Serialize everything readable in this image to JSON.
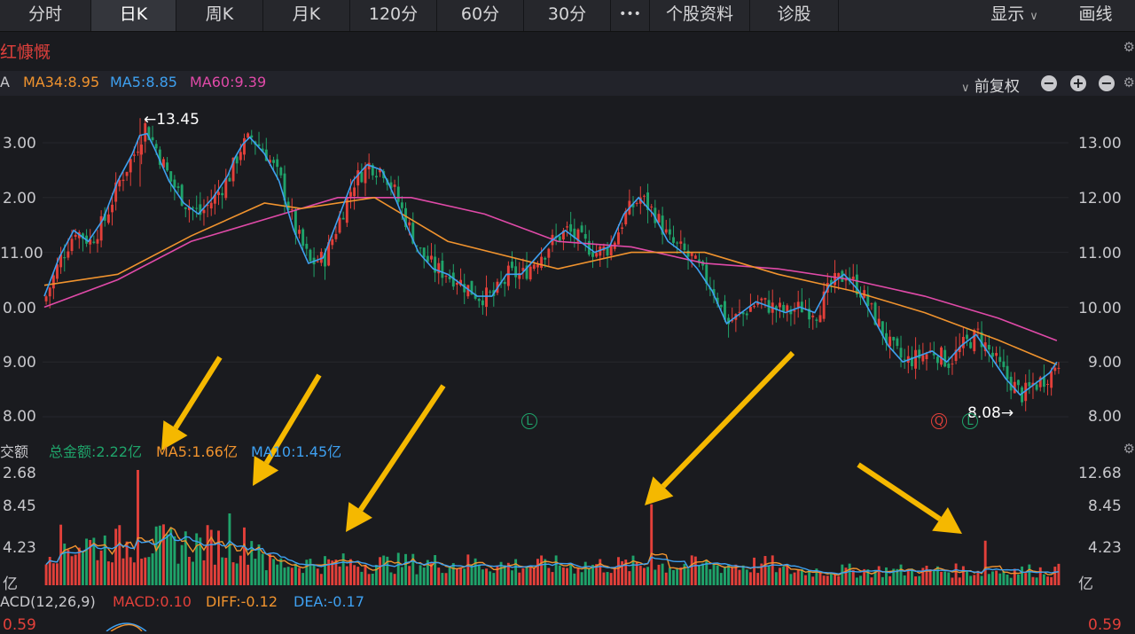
{
  "tabs": [
    "分时",
    "日K",
    "周K",
    "月K",
    "120分",
    "60分",
    "30分",
    "•••",
    "个股资料",
    "诊股"
  ],
  "active_tab": "日K",
  "right_tabs": {
    "display": "显示",
    "draw": "画线"
  },
  "stock_name": "红慷慨",
  "ma_header": {
    "prefix": "A",
    "ma34": "MA34:8.95",
    "ma5": "MA5:8.85",
    "ma60": "MA60:9.39",
    "adjust": "前复权",
    "btn_minus": "−",
    "btn_plus": "+",
    "btn_minus2": "−"
  },
  "colors": {
    "up": "#e3403a",
    "down": "#1fa36a",
    "ma5": "#3ea0f0",
    "ma34": "#f0932e",
    "ma60": "#e04aa8",
    "bg": "#1a1b1f",
    "arrow": "#f5b800"
  },
  "price_axis": {
    "left": [
      "3.00",
      "2.00",
      "11.00",
      "0.00",
      "9.00",
      "8.00"
    ],
    "right": [
      "13.00",
      "12.00",
      "11.00",
      "10.00",
      "9.00",
      "8.00"
    ]
  },
  "annotations": {
    "high": "←13.45",
    "low": "8.08→",
    "marker_l": "L",
    "marker_q": "Q"
  },
  "volume_header": {
    "prefix": "交额",
    "total": "总金额:2.22亿",
    "ma5": "MA5:1.66亿",
    "ma10": "MA10:1.45亿"
  },
  "volume_axis": {
    "left": [
      "2.68",
      "8.45",
      "4.23",
      "亿"
    ],
    "right": [
      "12.68",
      "8.45",
      "4.23",
      "亿"
    ]
  },
  "macd_header": {
    "prefix": "ACD(12,26,9)",
    "macd": "MACD:0.10",
    "diff": "DIFF:-0.12",
    "dea": "DEA:-0.17"
  },
  "macd_axis": {
    "left": "0.59",
    "right": "0.59"
  },
  "chart_data": {
    "type": "candlestick",
    "price_range": [
      8.0,
      13.0
    ],
    "high": 13.45,
    "low": 8.08,
    "close_path": [
      [
        0,
        10.2
      ],
      [
        4,
        10.9
      ],
      [
        8,
        11.4
      ],
      [
        12,
        11.2
      ],
      [
        16,
        11.6
      ],
      [
        20,
        12.3
      ],
      [
        24,
        12.8
      ],
      [
        27,
        13.3
      ],
      [
        30,
        12.9
      ],
      [
        34,
        12.3
      ],
      [
        38,
        11.9
      ],
      [
        42,
        11.7
      ],
      [
        46,
        12.0
      ],
      [
        50,
        12.4
      ],
      [
        53,
        12.9
      ],
      [
        56,
        13.1
      ],
      [
        60,
        12.8
      ],
      [
        64,
        12.3
      ],
      [
        68,
        11.4
      ],
      [
        72,
        10.8
      ],
      [
        76,
        10.9
      ],
      [
        80,
        11.6
      ],
      [
        84,
        12.3
      ],
      [
        88,
        12.6
      ],
      [
        92,
        12.5
      ],
      [
        95,
        12.1
      ],
      [
        98,
        11.6
      ],
      [
        102,
        11.0
      ],
      [
        106,
        10.7
      ],
      [
        110,
        10.6
      ],
      [
        114,
        10.4
      ],
      [
        118,
        10.2
      ],
      [
        122,
        10.2
      ],
      [
        126,
        10.6
      ],
      [
        130,
        10.6
      ],
      [
        134,
        10.9
      ],
      [
        138,
        11.2
      ],
      [
        142,
        11.4
      ],
      [
        146,
        11.2
      ],
      [
        150,
        11.0
      ],
      [
        154,
        11.1
      ],
      [
        158,
        11.7
      ],
      [
        162,
        12.0
      ],
      [
        166,
        11.7
      ],
      [
        170,
        11.2
      ],
      [
        174,
        11.0
      ],
      [
        178,
        10.7
      ],
      [
        182,
        10.3
      ],
      [
        186,
        9.7
      ],
      [
        190,
        9.9
      ],
      [
        194,
        10.1
      ],
      [
        198,
        10.0
      ],
      [
        202,
        9.9
      ],
      [
        206,
        10.0
      ],
      [
        210,
        9.9
      ],
      [
        214,
        10.4
      ],
      [
        218,
        10.6
      ],
      [
        222,
        10.3
      ],
      [
        226,
        9.8
      ],
      [
        230,
        9.3
      ],
      [
        234,
        9.0
      ],
      [
        238,
        9.1
      ],
      [
        242,
        9.2
      ],
      [
        246,
        9.0
      ],
      [
        250,
        9.3
      ],
      [
        254,
        9.5
      ],
      [
        258,
        9.1
      ],
      [
        262,
        8.7
      ],
      [
        266,
        8.4
      ],
      [
        270,
        8.6
      ],
      [
        274,
        8.8
      ],
      [
        276,
        9.0
      ]
    ],
    "ma34_path": [
      [
        0,
        10.4
      ],
      [
        20,
        10.6
      ],
      [
        40,
        11.3
      ],
      [
        60,
        11.9
      ],
      [
        70,
        11.8
      ],
      [
        90,
        12.0
      ],
      [
        110,
        11.2
      ],
      [
        140,
        10.7
      ],
      [
        160,
        11.0
      ],
      [
        180,
        11.0
      ],
      [
        200,
        10.6
      ],
      [
        220,
        10.3
      ],
      [
        240,
        9.9
      ],
      [
        260,
        9.4
      ],
      [
        276,
        8.95
      ]
    ],
    "ma60_path": [
      [
        0,
        10.0
      ],
      [
        20,
        10.5
      ],
      [
        40,
        11.2
      ],
      [
        60,
        11.6
      ],
      [
        80,
        12.0
      ],
      [
        100,
        12.0
      ],
      [
        120,
        11.7
      ],
      [
        140,
        11.2
      ],
      [
        160,
        11.1
      ],
      [
        180,
        10.8
      ],
      [
        200,
        10.7
      ],
      [
        220,
        10.5
      ],
      [
        240,
        10.2
      ],
      [
        260,
        9.8
      ],
      [
        276,
        9.39
      ]
    ],
    "volume_range": [
      0,
      12.68
    ],
    "volume_unit": "亿",
    "volume_spikes": [
      [
        25,
        12.68
      ],
      [
        50,
        7.9
      ],
      [
        165,
        8.9
      ],
      [
        256,
        4.9
      ]
    ],
    "macd": {
      "macd": 0.1,
      "diff": -0.12,
      "dea": -0.17
    }
  }
}
